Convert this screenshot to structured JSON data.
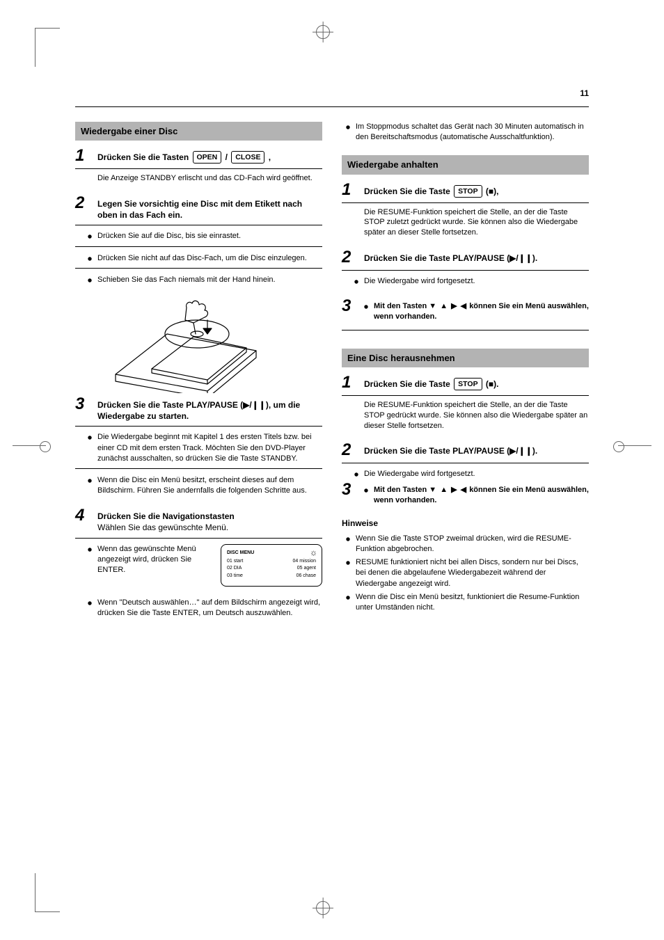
{
  "page_number": "11",
  "left": {
    "section_header": "Wiedergabe einer Disc",
    "steps": [
      {
        "num": "1",
        "head_pre": "Drücken Sie die Tasten ",
        "btn1": "OPEN",
        "head_mid": " / ",
        "btn2": "CLOSE",
        "head_post": ",",
        "body": "Die Anzeige STANDBY erlischt und das CD-Fach wird geöffnet."
      },
      {
        "num": "2",
        "head_pre": "Legen Sie vorsichtig eine Disc mit dem Etikett nach oben in das Fach ein."
      }
    ],
    "tray_caption_top": "",
    "step3": {
      "num": "3",
      "head_pre": "Drücken Sie die Taste PLAY/PAUSE (",
      "head_sym": "▶/❙❙",
      "head_post": "), um die Wiedergabe zu starten."
    },
    "step3_bullets": [
      "Die Wiedergabe beginnt mit Kapitel 1 des ersten Titels bzw. bei einer CD mit dem ersten Track. Möchten Sie den DVD-Player zunächst ausschalten, so drücken Sie die Taste STANDBY.",
      "Wenn die Disc ein Menü besitzt, erscheint dieses auf dem Bildschirm. Führen Sie andernfalls die folgenden Schritte aus."
    ],
    "step4": {
      "num": "4",
      "head": "Drücken Sie die Navigationstasten",
      "subhead": "Wählen Sie das gewünschte Menü."
    },
    "step4_bullets": [
      "Wenn das gewünschte Menü angezeigt wird, drücken Sie ENTER."
    ],
    "disc_menu": {
      "title": "DISC MENU",
      "rows": [
        [
          "01 start",
          "04 mission"
        ],
        [
          "02 DIA",
          "05 agent"
        ],
        [
          "03 time",
          "06 chase"
        ]
      ],
      "glyph": "☼"
    },
    "after_discmenu_bullet": "Wenn \"Deutsch auswählen…\" auf dem Bildschirm angezeigt wird, drücken Sie die Taste ENTER, um Deutsch auszuwählen."
  },
  "right": {
    "pre_bullet": "Im Stoppmodus schaltet das Gerät nach 30 Minuten automatisch in den Bereitschaftsmodus (automatische Ausschaltfunktion).",
    "sectionA_header": "Wiedergabe anhalten",
    "sectionA_step1": {
      "num": "1",
      "head_pre": "Drücken Sie die Taste ",
      "btn": "STOP",
      "head_post": "  (■),",
      "body": "Die RESUME-Funktion speichert die Stelle, an der die Taste STOP zuletzt gedrückt wurde. Sie können also die Wiedergabe später an dieser Stelle fortsetzen."
    },
    "sectionA_step2": {
      "num": "2",
      "head": "Drücken Sie die Taste PLAY/PAUSE (▶/❙❙)."
    },
    "sectionA_step2_bullet": "Die Wiedergabe wird fortgesetzt.",
    "sectionA_step3": {
      "num": "3",
      "head_pre": "Mit den Tasten ",
      "arrows": "▼ ▲ ▶ ◀",
      "head_post": " können Sie ein Menü auswählen, wenn vorhanden."
    },
    "sectionB_header": "Eine Disc herausnehmen",
    "sectionB_step1": {
      "num": "1",
      "head_pre": "Drücken Sie die Taste ",
      "btn": "STOP",
      "head_post": "  (■).",
      "body": "Die RESUME-Funktion speichert die Stelle, an der die Taste STOP gedrückt wurde. Sie können also die Wiedergabe später an dieser Stelle fortsetzen."
    },
    "sectionB_step2": {
      "num": "2",
      "head": "Drücken Sie die Taste PLAY/PAUSE (▶/❙❙)."
    },
    "sectionB_step2_bullet": "Die Wiedergabe wird fortgesetzt.",
    "sectionB_step3": {
      "num": "3",
      "head_pre": "Mit den Tasten ",
      "arrows": "▼ ▲ ▶ ◀",
      "head_post": " können Sie ein Menü auswählen, wenn vorhanden."
    },
    "notes_title": "Hinweise",
    "notes": [
      "Wenn Sie die Taste STOP zweimal drücken, wird die RESUME-Funktion abgebrochen.",
      "RESUME funktioniert nicht bei allen Discs, sondern nur bei Discs, bei denen die abgelaufene Wiedergabezeit während der Wiedergabe angezeigt wird.",
      "Wenn die Disc ein Menü besitzt, funktioniert die Resume-Funktion unter Umständen nicht."
    ]
  }
}
